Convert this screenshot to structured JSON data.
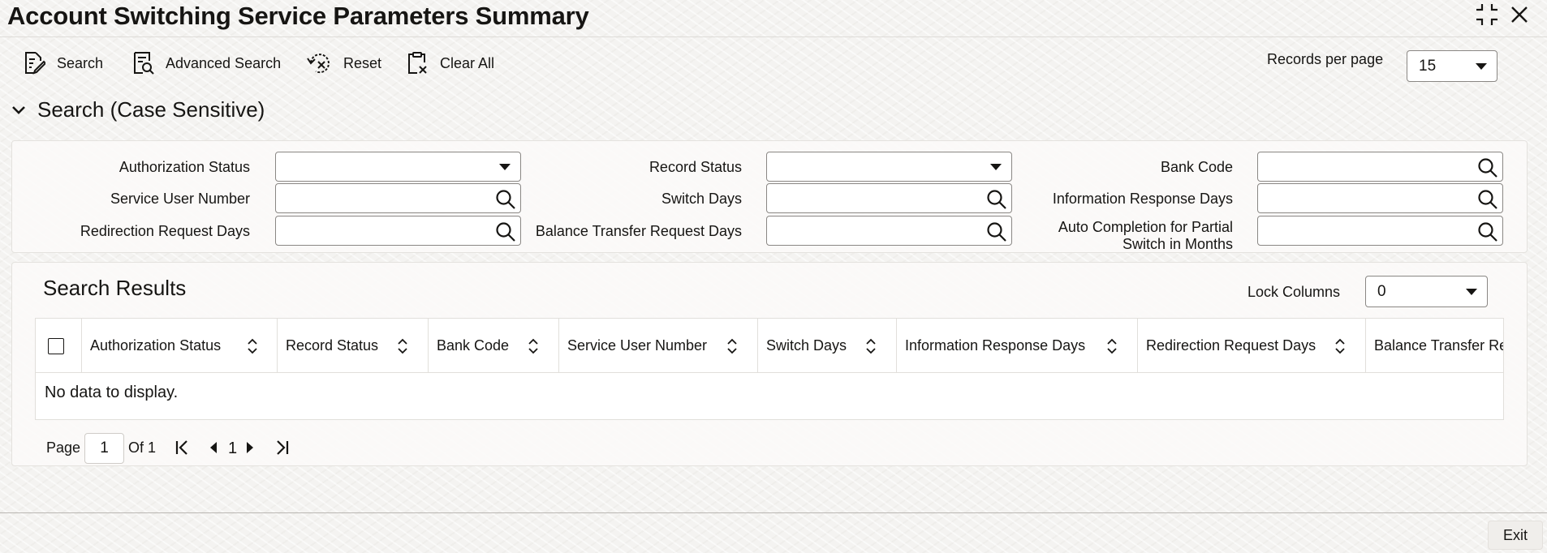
{
  "header": {
    "title": "Account Switching Service Parameters Summary"
  },
  "toolbar": {
    "search_label": "Search",
    "advanced_search_label": "Advanced Search",
    "reset_label": "Reset",
    "clear_all_label": "Clear All",
    "records_per_page_label": "Records per page",
    "records_per_page_value": "15"
  },
  "search_section": {
    "title": "Search (Case Sensitive)",
    "fields": {
      "authorization_status": "Authorization Status",
      "record_status": "Record Status",
      "bank_code": "Bank Code",
      "service_user_number": "Service User Number",
      "switch_days": "Switch Days",
      "information_response_days": "Information Response Days",
      "redirection_request_days": "Redirection Request Days",
      "balance_transfer_request_days": "Balance Transfer Request Days",
      "auto_completion_line1": "Auto Completion for Partial",
      "auto_completion_line2": "Switch in Months"
    }
  },
  "results": {
    "title": "Search Results",
    "lock_columns_label": "Lock Columns",
    "lock_columns_value": "0",
    "columns": [
      "Authorization Status",
      "Record Status",
      "Bank Code",
      "Service User Number",
      "Switch Days",
      "Information Response Days",
      "Redirection Request Days",
      "Balance Transfer Re"
    ],
    "empty_message": "No data to display."
  },
  "pagination": {
    "page_label": "Page",
    "page_value": "1",
    "of_label": "Of 1",
    "current_page": "1"
  },
  "footer": {
    "exit_label": "Exit"
  }
}
